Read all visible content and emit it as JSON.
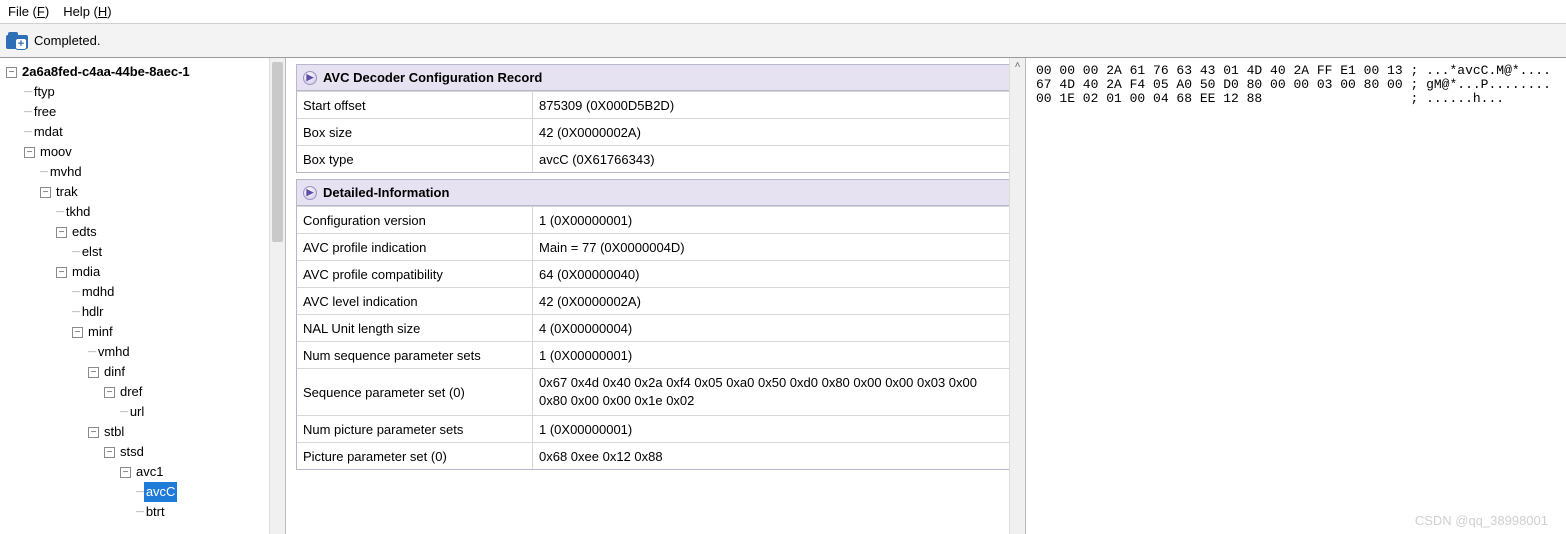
{
  "menu": {
    "file": "File (F)",
    "help": "Help (H)"
  },
  "status": {
    "text": "Completed."
  },
  "tree": {
    "root": "2a6a8fed-c4aa-44be-8aec-1",
    "items": {
      "ftyp": "ftyp",
      "free": "free",
      "mdat": "mdat",
      "moov": "moov",
      "mvhd": "mvhd",
      "trak": "trak",
      "tkhd": "tkhd",
      "edts": "edts",
      "elst": "elst",
      "mdia": "mdia",
      "mdhd": "mdhd",
      "hdlr": "hdlr",
      "minf": "minf",
      "vmhd": "vmhd",
      "dinf": "dinf",
      "dref": "dref",
      "url": "url",
      "stbl": "stbl",
      "stsd": "stsd",
      "avc1": "avc1",
      "avcC": "avcC",
      "btrt": "btrt"
    }
  },
  "sections": {
    "s1": {
      "title": "AVC Decoder Configuration Record",
      "rows": {
        "start_offset": {
          "k": "Start offset",
          "v": "875309 (0X000D5B2D)"
        },
        "box_size": {
          "k": "Box size",
          "v": "42 (0X0000002A)"
        },
        "box_type": {
          "k": "Box type",
          "v": "avcC (0X61766343)"
        }
      }
    },
    "s2": {
      "title": "Detailed-Information",
      "rows": {
        "cfg_ver": {
          "k": "Configuration version",
          "v": "1 (0X00000001)"
        },
        "prof_ind": {
          "k": "AVC profile indication",
          "v": "Main = 77 (0X0000004D)"
        },
        "prof_comp": {
          "k": "AVC profile compatibility",
          "v": "64 (0X00000040)"
        },
        "level_ind": {
          "k": "AVC level indication",
          "v": "42 (0X0000002A)"
        },
        "nal_len": {
          "k": "NAL Unit length size",
          "v": "4 (0X00000004)"
        },
        "num_sps": {
          "k": "Num sequence parameter sets",
          "v": "1 (0X00000001)"
        },
        "sps0": {
          "k": "Sequence parameter set (0)",
          "v": "0x67 0x4d 0x40 0x2a 0xf4 0x05 0xa0 0x50 0xd0 0x80 0x00 0x00 0x03 0x00 0x80 0x00 0x00 0x1e 0x02"
        },
        "num_pps": {
          "k": "Num picture parameter sets",
          "v": "1 (0X00000001)"
        },
        "pps0": {
          "k": "Picture parameter set (0)",
          "v": "0x68 0xee 0x12 0x88"
        }
      }
    }
  },
  "hex": "00 00 00 2A 61 76 63 43 01 4D 40 2A FF E1 00 13 ; ...*avcC.M@*....\n67 4D 40 2A F4 05 A0 50 D0 80 00 00 03 00 80 00 ; gM@*...P........\n00 1E 02 01 00 04 68 EE 12 88                   ; ......h...",
  "watermark": "CSDN @qq_38998001"
}
